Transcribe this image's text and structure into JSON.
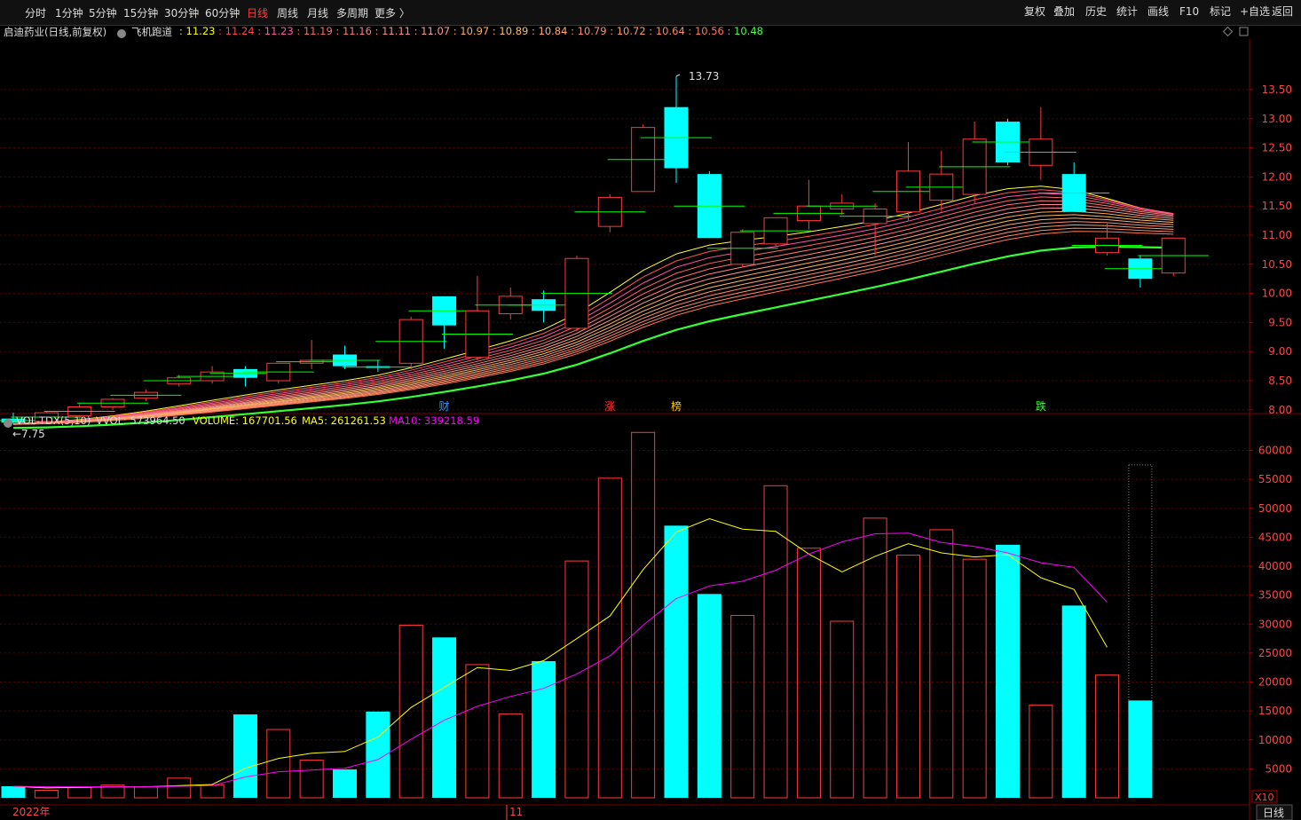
{
  "toolbar": {
    "periods": [
      "分时",
      "1分钟",
      "5分钟",
      "15分钟",
      "30分钟",
      "60分钟",
      "日线",
      "周线",
      "月线",
      "多周期",
      "更多 〉"
    ],
    "active_period": "日线",
    "right_buttons": [
      "复权",
      "叠加",
      "历史",
      "统计",
      "画线",
      "F10",
      "标记",
      "+自选",
      "返回"
    ]
  },
  "info": {
    "stock_title": "启迪药业(日线,前复权)",
    "indicator_name": "飞机跑道",
    "indicator_values": [
      {
        "v": "11.23",
        "color": "#ffff00"
      },
      {
        "v": "11.24",
        "color": "#ff4444"
      },
      {
        "v": "11.23",
        "color": "#ff55aa"
      },
      {
        "v": "11.19",
        "color": "#ff6666"
      },
      {
        "v": "11.16",
        "color": "#ff7777"
      },
      {
        "v": "11.11",
        "color": "#ff8888"
      },
      {
        "v": "11.07",
        "color": "#ff9999"
      },
      {
        "v": "10.97",
        "color": "#ffaa55"
      },
      {
        "v": "10.89",
        "color": "#ffbb66"
      },
      {
        "v": "10.84",
        "color": "#ffaa77"
      },
      {
        "v": "10.79",
        "color": "#ff8877"
      },
      {
        "v": "10.72",
        "color": "#ff9966"
      },
      {
        "v": "10.64",
        "color": "#ff8866"
      },
      {
        "v": "10.56",
        "color": "#ff7755"
      },
      {
        "v": "10.48",
        "color": "#44ff44"
      }
    ]
  },
  "vol_info": {
    "name": "VOL-TDX(5,10)",
    "vvol": "VVOL: 573964.50",
    "volume": "VOLUME: 167701.56",
    "ma5": "MA5: 261261.53",
    "ma10": "MA10: 339218.59"
  },
  "price_axis": {
    "labels": [
      "13.50",
      "13.00",
      "12.50",
      "12.00",
      "11.50",
      "11.00",
      "10.50",
      "10.00",
      "9.50",
      "9.00",
      "8.50",
      "8.00"
    ]
  },
  "volume_axis": {
    "labels": [
      "60000",
      "55000",
      "50000",
      "45000",
      "40000",
      "35000",
      "30000",
      "25000",
      "20000",
      "15000",
      "10000",
      "5000"
    ],
    "unit": "X10"
  },
  "annotations": {
    "high": "13.73",
    "low": "←7.75",
    "markers": [
      {
        "text": "财",
        "idx": 13,
        "color": "#3399ff"
      },
      {
        "text": "涨",
        "idx": 18,
        "color": "#ff3333"
      },
      {
        "text": "榜",
        "idx": 20,
        "color": "#ffcc00"
      },
      {
        "text": "跌",
        "idx": 31,
        "color": "#33ff33"
      }
    ]
  },
  "date_axis": {
    "labels": [
      "2022年",
      "11"
    ],
    "period": "日线"
  },
  "colors": {
    "up": "#ff3b3b",
    "down": "#00ffff",
    "ma5": "#ffff00",
    "ma10": "#ff00ff",
    "grid": "#5a0000",
    "flat": "#00ff00"
  },
  "chart_data": {
    "type": "candlestick",
    "candles": [
      {
        "o": 7.85,
        "h": 7.95,
        "l": 7.75,
        "c": 7.78
      },
      {
        "o": 7.8,
        "h": 7.98,
        "l": 7.78,
        "c": 7.95
      },
      {
        "o": 7.9,
        "h": 8.1,
        "l": 7.85,
        "c": 8.05
      },
      {
        "o": 8.05,
        "h": 8.2,
        "l": 8.0,
        "c": 8.18
      },
      {
        "o": 8.2,
        "h": 8.35,
        "l": 8.15,
        "c": 8.3
      },
      {
        "o": 8.45,
        "h": 8.6,
        "l": 8.4,
        "c": 8.55
      },
      {
        "o": 8.5,
        "h": 8.75,
        "l": 8.45,
        "c": 8.65
      },
      {
        "o": 8.7,
        "h": 8.75,
        "l": 8.4,
        "c": 8.55
      },
      {
        "o": 8.5,
        "h": 8.8,
        "l": 8.45,
        "c": 8.8
      },
      {
        "o": 8.8,
        "h": 9.2,
        "l": 8.7,
        "c": 8.85
      },
      {
        "o": 8.95,
        "h": 9.1,
        "l": 8.7,
        "c": 8.75
      },
      {
        "o": 8.75,
        "h": 8.85,
        "l": 8.65,
        "c": 8.72
      },
      {
        "o": 8.8,
        "h": 9.6,
        "l": 8.7,
        "c": 9.55
      },
      {
        "o": 9.95,
        "h": 9.95,
        "l": 9.05,
        "c": 9.45
      },
      {
        "o": 8.9,
        "h": 10.3,
        "l": 8.85,
        "c": 9.7
      },
      {
        "o": 9.65,
        "h": 10.1,
        "l": 9.55,
        "c": 9.95
      },
      {
        "o": 9.9,
        "h": 10.05,
        "l": 9.5,
        "c": 9.7
      },
      {
        "o": 9.4,
        "h": 10.65,
        "l": 9.35,
        "c": 10.6
      },
      {
        "o": 11.15,
        "h": 11.7,
        "l": 11.05,
        "c": 11.65
      },
      {
        "o": 11.75,
        "h": 12.9,
        "l": 11.75,
        "c": 12.85
      },
      {
        "o": 13.2,
        "h": 13.73,
        "l": 11.9,
        "c": 12.15
      },
      {
        "o": 12.05,
        "h": 12.1,
        "l": 10.95,
        "c": 10.95
      },
      {
        "o": 10.5,
        "h": 11.1,
        "l": 10.45,
        "c": 11.05
      },
      {
        "o": 10.85,
        "h": 11.3,
        "l": 10.8,
        "c": 11.3
      },
      {
        "o": 11.25,
        "h": 11.95,
        "l": 11.1,
        "c": 11.5
      },
      {
        "o": 11.45,
        "h": 11.7,
        "l": 11.35,
        "c": 11.55
      },
      {
        "o": 11.2,
        "h": 11.55,
        "l": 10.65,
        "c": 11.45
      },
      {
        "o": 11.4,
        "h": 12.6,
        "l": 11.25,
        "c": 12.1
      },
      {
        "o": 11.6,
        "h": 12.45,
        "l": 11.4,
        "c": 12.05
      },
      {
        "o": 11.7,
        "h": 12.95,
        "l": 11.55,
        "c": 12.65
      },
      {
        "o": 12.95,
        "h": 13.0,
        "l": 12.2,
        "c": 12.25
      },
      {
        "o": 12.2,
        "h": 13.2,
        "l": 11.95,
        "c": 12.65
      },
      {
        "o": 12.05,
        "h": 12.25,
        "l": 11.4,
        "c": 11.4
      },
      {
        "o": 10.7,
        "h": 11.2,
        "l": 10.65,
        "c": 10.95
      },
      {
        "o": 10.6,
        "h": 10.65,
        "l": 10.1,
        "c": 10.25
      },
      {
        "o": 10.35,
        "h": 10.95,
        "l": 10.3,
        "c": 10.95
      }
    ],
    "volume": [
      2000,
      1300,
      1800,
      2200,
      1900,
      3400,
      2200,
      14400,
      11800,
      6500,
      4900,
      14900,
      29800,
      27700,
      23000,
      14500,
      23600,
      40900,
      55200,
      63100,
      47000,
      35200,
      31500,
      53900,
      43100,
      30500,
      48300,
      41900,
      46300,
      41200,
      43700,
      16000,
      33200,
      21200,
      16800
    ],
    "volume_ghost": 57500,
    "ma5": [
      2000,
      1700,
      1800,
      1900,
      1900,
      2100,
      2300,
      5100,
      6800,
      7700,
      8000,
      10500,
      15600,
      19100,
      22500,
      22000,
      23700,
      27500,
      31400,
      39400,
      45900,
      48200,
      46400,
      46000,
      42100,
      39000,
      41700,
      43900,
      42300,
      41600,
      42000,
      38000,
      36000,
      26000
    ],
    "ma10": [
      2000,
      1900,
      1900,
      1900,
      1900,
      2000,
      2100,
      3600,
      4500,
      4800,
      5100,
      6600,
      10100,
      13400,
      15800,
      17500,
      18900,
      21400,
      24500,
      29800,
      34400,
      36600,
      37400,
      39300,
      42100,
      44200,
      45600,
      45700,
      44100,
      43400,
      42300,
      40600,
      39800,
      33800
    ]
  }
}
